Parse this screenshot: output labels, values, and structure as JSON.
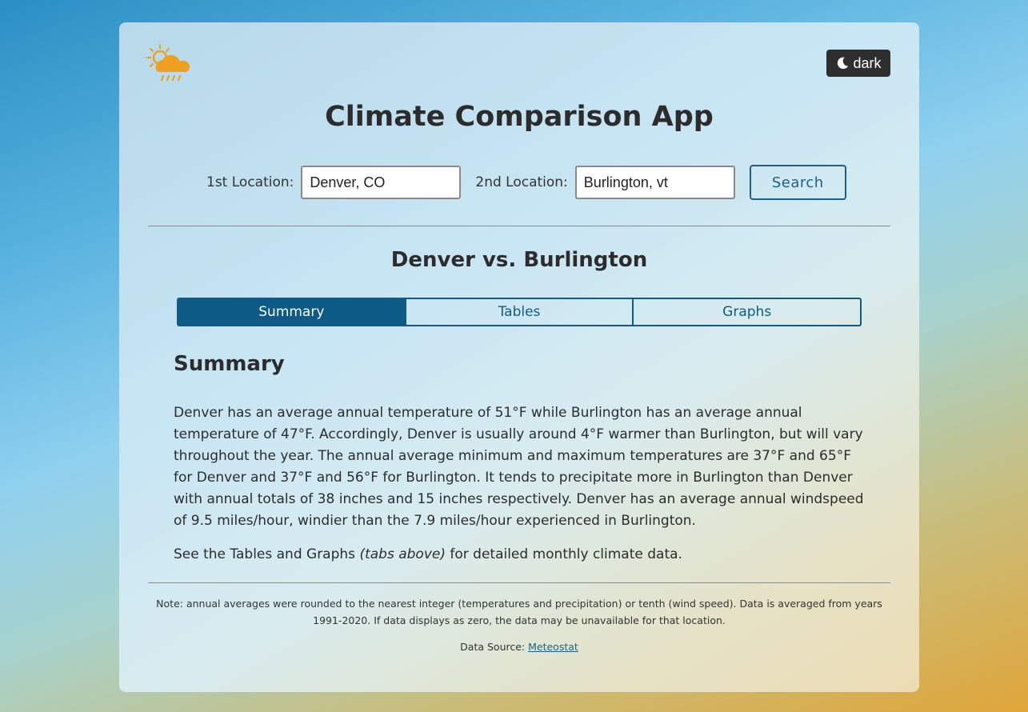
{
  "header": {
    "dark_mode_label": "dark",
    "title": "Climate Comparison App"
  },
  "search": {
    "location1_label": "1st Location:",
    "location1_value": "Denver, CO",
    "location2_label": "2nd Location:",
    "location2_value": "Burlington, vt",
    "button_label": "Search"
  },
  "comparison": {
    "title": "Denver vs. Burlington",
    "tabs": [
      {
        "label": "Summary",
        "active": true
      },
      {
        "label": "Tables",
        "active": false
      },
      {
        "label": "Graphs",
        "active": false
      }
    ]
  },
  "summary": {
    "heading": "Summary",
    "paragraph": "Denver has an average annual temperature of 51°F while Burlington has an average annual temperature of 47°F. Accordingly, Denver is usually around 4°F warmer than Burlington, but will vary throughout the year. The annual average minimum and maximum temperatures are 37°F and 65°F for Denver and 37°F and 56°F for Burlington. It tends to precipitate more in Burlington than Denver with annual totals of 38 inches and 15 inches respectively. Denver has an average annual windspeed of 9.5 miles/hour, windier than the 7.9 miles/hour experienced in Burlington.",
    "see_prefix": "See the Tables and Graphs ",
    "see_italic": "(tabs above)",
    "see_suffix": " for detailed monthly climate data."
  },
  "footer": {
    "note": "Note: annual averages were rounded to the nearest integer (temperatures and precipitation) or tenth (wind speed). Data is averaged from years 1991-2020. If data displays as zero, the data may be unavailable for that location.",
    "source_label": "Data Source: ",
    "source_link": "Meteostat"
  },
  "icons": {
    "logo": "sun-cloud-rain-icon",
    "dark_mode": "moon-icon"
  },
  "colors": {
    "accent": "#0d5a86",
    "logo_orange": "#f0a020",
    "dark_button": "#2e2e2e"
  }
}
